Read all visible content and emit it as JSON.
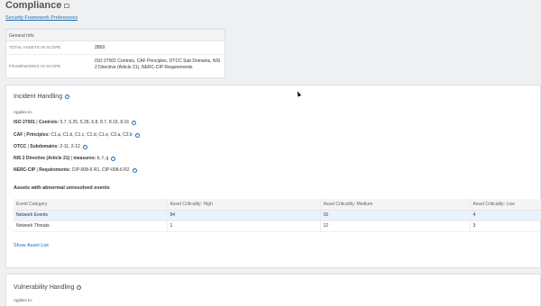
{
  "page": {
    "title": "Compliance",
    "pref_link": "Security Framework Preferences"
  },
  "general_info": {
    "header": "General Info",
    "rows": [
      {
        "key": "TOTAL ASSETS IN SCOPE",
        "value": "2869"
      },
      {
        "key": "FRAMEWORKS IN SCOPE",
        "value": "ISO 27001 Controls, CAF Principles, OTCC Sub Domains, NIS 2 Directive (Article 21), NERC-CIP Requirements"
      }
    ]
  },
  "incident": {
    "title": "Incident Handling",
    "applies_to": "Applies to:",
    "frameworks": [
      {
        "name": "ISO 27001",
        "label": "Controls:",
        "items": "5.7, 5.25, 5.28, 6.8, 8.7, 8.15, 8.16"
      },
      {
        "name": "CAF",
        "label": "Principles:",
        "items": "C1.a, C1.b, C1.c, C1.d, C1.e, C2.a, C2.b"
      },
      {
        "name": "OTCC",
        "label": "Subdomains:",
        "items": "2-11, 2-12"
      },
      {
        "name": "NIS 2 Directive (Article 21)",
        "label": "measures:",
        "items": "b, f, g"
      },
      {
        "name": "NERC-CIP",
        "label": "Requirements:",
        "items": "CIP-008-6 R1, CIP-008-6 R2"
      }
    ],
    "abnormal_title": "Assets with abnormal unresolved events",
    "table": {
      "headers": [
        "Event Category",
        "Asset Criticality: High",
        "Asset Criticality: Medium",
        "Asset Criticality: Low"
      ],
      "rows": [
        [
          "Network Events",
          "94",
          "16",
          "4"
        ],
        [
          "Network Threats",
          "1",
          "12",
          "3"
        ]
      ]
    },
    "show_asset_list": "Show Asset List"
  },
  "vulnerability": {
    "title": "Vulnerability Handling",
    "applies_to": "Applies to:"
  },
  "icons": {
    "info": "i",
    "title_icon": "monitor-icon"
  },
  "colors": {
    "link": "#1f6fb5",
    "highlight_row": "#eaf3fb"
  }
}
